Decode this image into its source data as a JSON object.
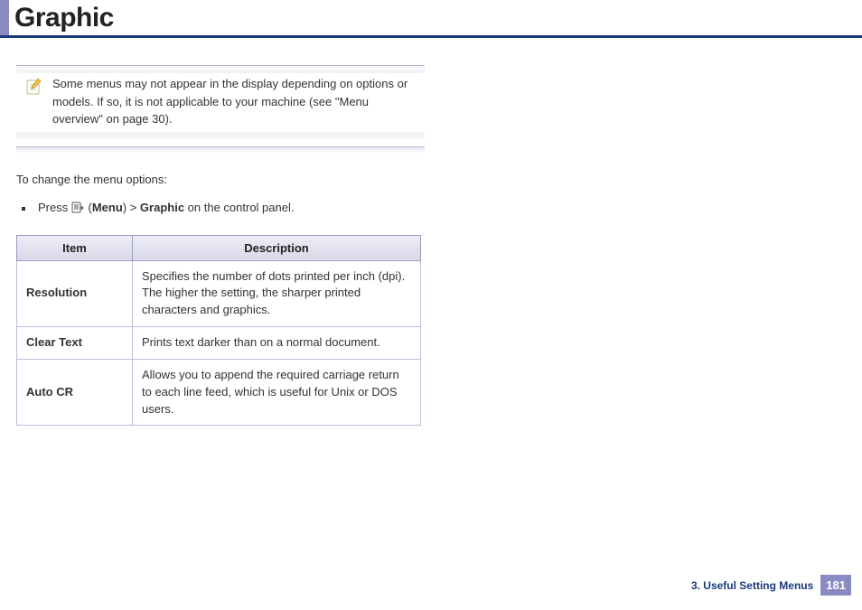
{
  "header": {
    "title": "Graphic"
  },
  "note": {
    "text": "Some menus may not appear in the display depending on options or models. If so, it is not applicable to your machine (see \"Menu overview\" on page 30)."
  },
  "intro": "To change the menu options:",
  "instruction": {
    "prefix": "Press ",
    "menu_open": " (",
    "menu_label": "Menu",
    "menu_close": ") > ",
    "graphic_label": "Graphic",
    "suffix": " on the control panel."
  },
  "table": {
    "headers": {
      "item": "Item",
      "description": "Description"
    },
    "rows": [
      {
        "item": "Resolution",
        "description": "Specifies the number of dots printed per inch (dpi). The higher the setting, the sharper printed characters and graphics."
      },
      {
        "item": "Clear Text",
        "description": "Prints text darker than on a normal document."
      },
      {
        "item": "Auto CR",
        "description": "Allows you to append the required carriage return to each line feed, which is useful for Unix or DOS users."
      }
    ]
  },
  "footer": {
    "chapter": "3.  Useful Setting Menus",
    "page": "181"
  }
}
